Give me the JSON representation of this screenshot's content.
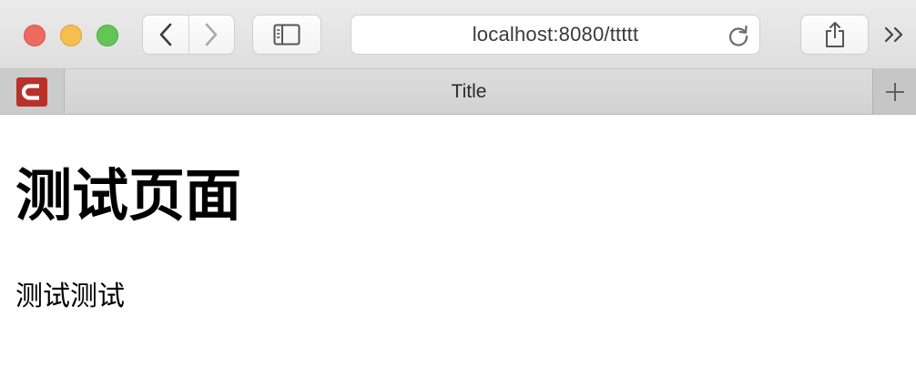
{
  "browser": {
    "address_bar": {
      "url": "localhost:8080/ttttt"
    },
    "tabs": [
      {
        "type": "pinned",
        "favicon": "c-logo-icon",
        "favicon_color": "#b8312a"
      },
      {
        "type": "active",
        "title": "Title"
      }
    ],
    "toolbar_icons": [
      "back-chevron-icon",
      "forward-chevron-icon",
      "sidebar-icon",
      "reload-icon",
      "share-icon",
      "overflow-chevrons-icon",
      "plus-icon"
    ],
    "window_controls": {
      "close_color": "#ee6a5f",
      "minimize_color": "#f5be4f",
      "maximize_color": "#62c655"
    }
  },
  "page": {
    "heading": "测试页面",
    "paragraph": "测试测试"
  }
}
